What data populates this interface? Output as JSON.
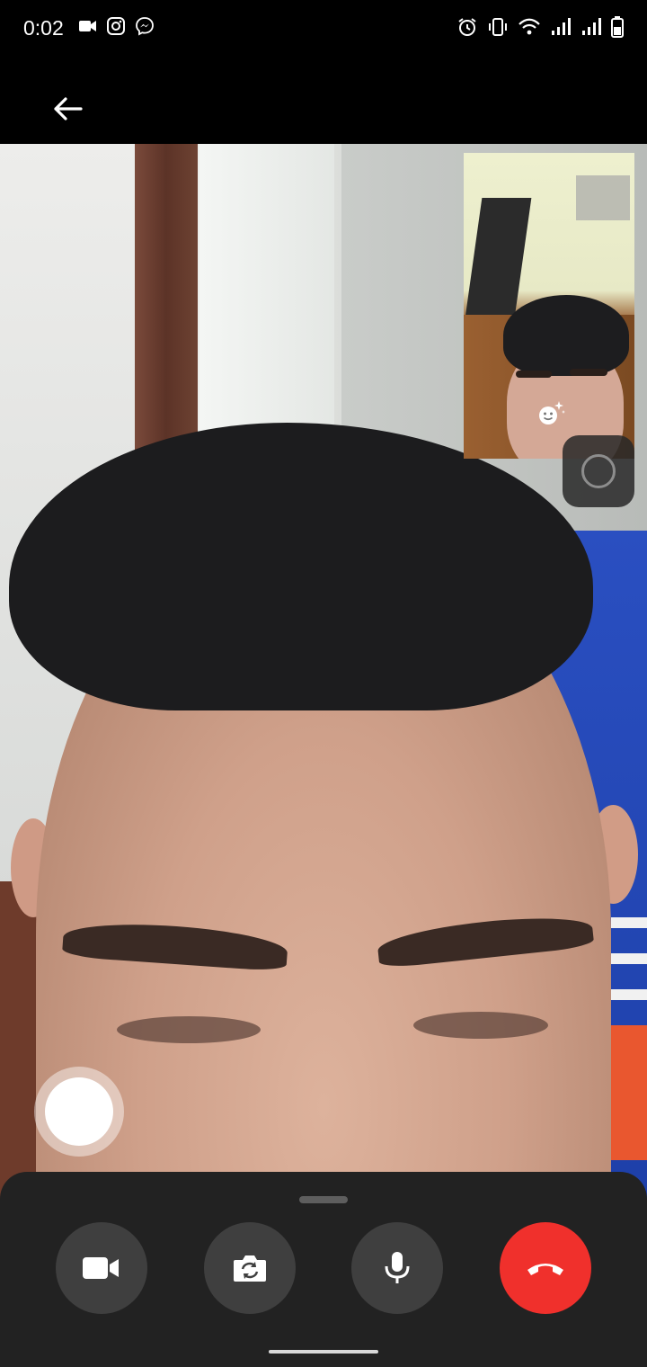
{
  "status_bar": {
    "time": "0:02",
    "left_icons": [
      "video-icon",
      "instagram-icon",
      "messenger-icon"
    ],
    "right_icons": [
      "alarm-icon",
      "vibrate-icon",
      "wifi-icon",
      "signal-icon",
      "signal-icon",
      "battery-icon"
    ]
  },
  "header": {
    "back_icon": "arrow-left-icon"
  },
  "call": {
    "self_view": {
      "effects_icon": "face-effects-icon"
    },
    "flip_icon": "circle-icon"
  },
  "controls": [
    {
      "name": "video-toggle",
      "icon": "video-camera-icon"
    },
    {
      "name": "switch-camera",
      "icon": "camera-flip-icon"
    },
    {
      "name": "mute",
      "icon": "microphone-icon"
    },
    {
      "name": "end-call",
      "icon": "phone-hangup-icon",
      "color": "#f0302c"
    }
  ],
  "colors": {
    "panel": "#222222",
    "button": "#3f3f3f",
    "end_call": "#f0302c"
  }
}
